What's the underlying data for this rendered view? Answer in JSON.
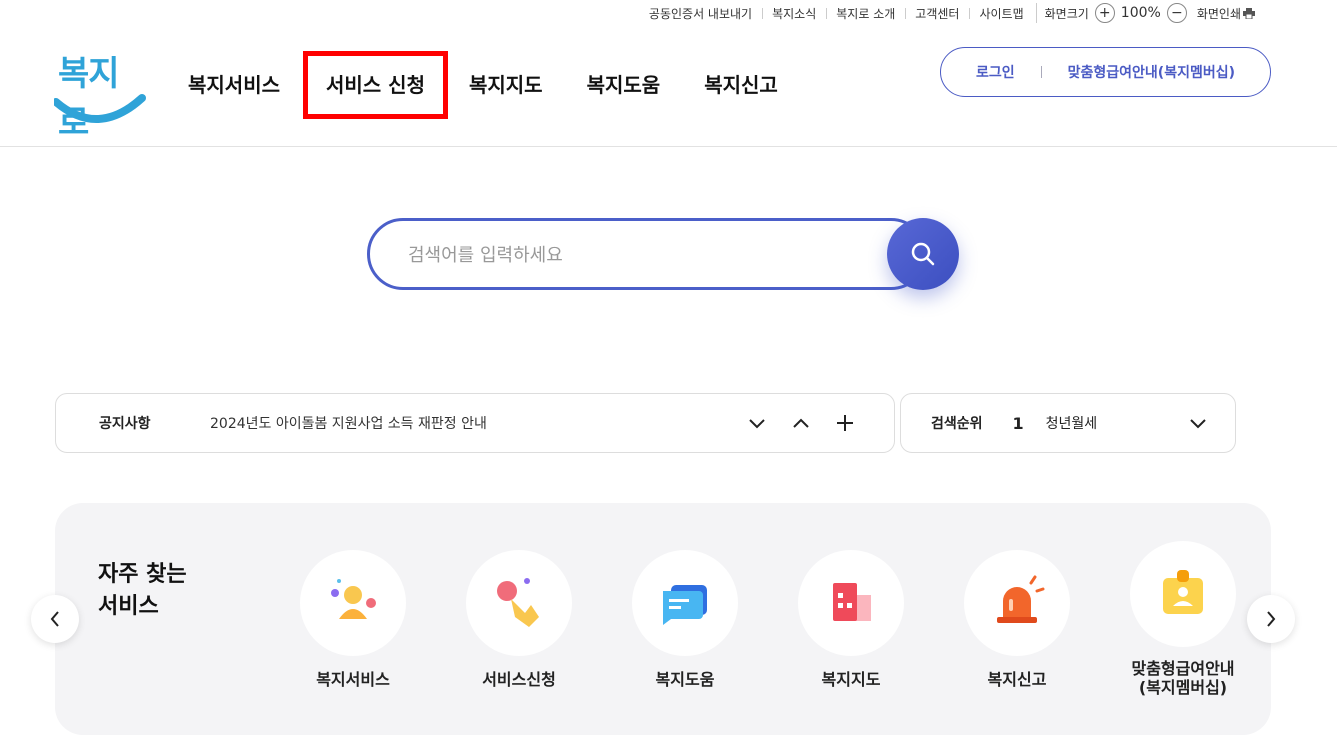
{
  "util": {
    "links": [
      "공동인증서 내보내기",
      "복지소식",
      "복지로 소개",
      "고객센터",
      "사이트맵"
    ],
    "zoom_label": "화면크기",
    "zoom_in": "+",
    "zoom_value": "100%",
    "zoom_out": "−",
    "print_label": "화면인쇄"
  },
  "header": {
    "logo_text": "복지로",
    "nav": [
      "복지서비스",
      "서비스 신청",
      "복지지도",
      "복지도움",
      "복지신고"
    ],
    "login": "로그인",
    "membership": "맞춤형급여안내(복지멤버십)"
  },
  "search": {
    "placeholder": "검색어를 입력하세요"
  },
  "notice": {
    "label": "공지사항",
    "text": "2024년도 아이돌봄 지원사업 소득 재판정 안내"
  },
  "ranking": {
    "label": "검색순위",
    "rank": "1",
    "keyword": "청년월세"
  },
  "frequent": {
    "title_line1": "자주 찾는",
    "title_line2": "서비스",
    "items": [
      {
        "label": "복지서비스",
        "icon": "person-icon"
      },
      {
        "label": "서비스신청",
        "icon": "hand-pointer-icon"
      },
      {
        "label": "복지도움",
        "icon": "chat-bubble-icon"
      },
      {
        "label": "복지지도",
        "icon": "map-building-icon"
      },
      {
        "label": "복지신고",
        "icon": "siren-icon"
      },
      {
        "label": "맞춤형급여안내\n(복지멤버십)",
        "label_line1": "맞춤형급여안내",
        "label_line2": "(복지멤버십)",
        "icon": "id-badge-icon"
      }
    ]
  },
  "colors": {
    "accent": "#4b5bc4",
    "logo": "#2fa3d8",
    "highlight": "#ff0000"
  }
}
